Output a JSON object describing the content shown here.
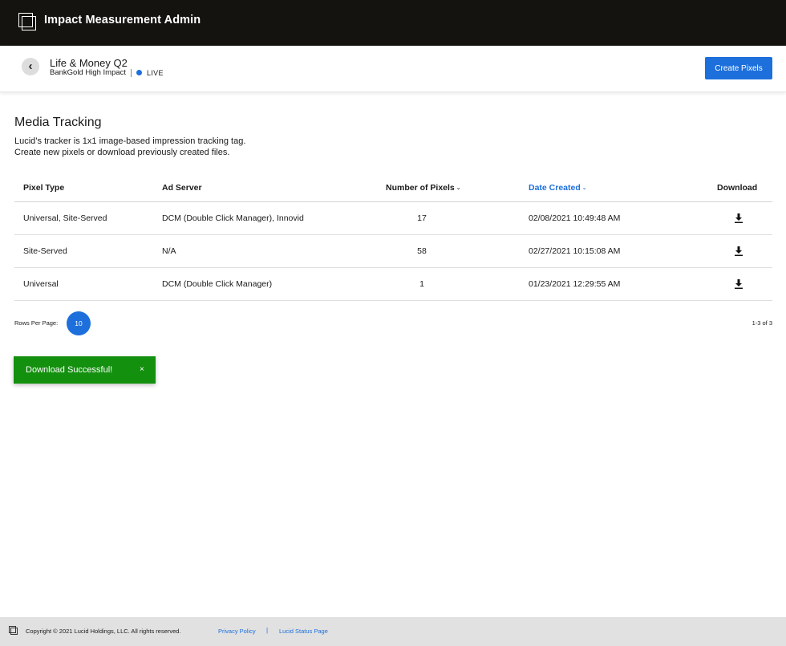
{
  "app": {
    "title": "Impact Measurement Admin",
    "logo_icon": "stacked-squares-logo-icon"
  },
  "subheader": {
    "back_icon": "chevron-left-icon",
    "campaign_title": "Life & Money Q2",
    "campaign_subtitle": "BankGold High Impact",
    "status": "LIVE",
    "status_color": "#1d6fdc",
    "create_button_label": "Create Pixels"
  },
  "section": {
    "title": "Media Tracking",
    "description_line1": "Lucid’s tracker is 1x1 image-based impression tracking tag.",
    "description_line2": "Create new pixels or download previously created files."
  },
  "table": {
    "headers": {
      "pixel_type": "Pixel Type",
      "ad_server": "Ad Server",
      "number_of_pixels": "Number of Pixels",
      "date_created": "Date Created",
      "download": "Download"
    },
    "sorted_by": "Date Created",
    "rows": [
      {
        "pixel_type": "Universal, Site-Served",
        "ad_server": "DCM (Double Click Manager), Innovid",
        "number_of_pixels": "17",
        "date_created": "02/08/2021 10:49:48 AM",
        "download_icon": "download-icon"
      },
      {
        "pixel_type": "Site-Served",
        "ad_server": "N/A",
        "number_of_pixels": "58",
        "date_created": "02/27/2021 10:15:08 AM",
        "download_icon": "download-icon"
      },
      {
        "pixel_type": "Universal",
        "ad_server": "DCM (Double Click Manager)",
        "number_of_pixels": "1",
        "date_created": "01/23/2021 12:29:55 AM",
        "download_icon": "download-icon"
      }
    ]
  },
  "pagination": {
    "rows_per_page_label": "Rows Per Page:",
    "rows_per_page_value": "10",
    "range": "1-3 of 3"
  },
  "toast": {
    "message": "Download Successful!",
    "close_label": "×",
    "color": "#14900f"
  },
  "footer": {
    "copyright": "Copyright © 2021 Lucid Holdings, LLC. All rights reserved.",
    "privacy_link": "Privacy Policy",
    "separator": "|",
    "status_link": "Lucid Status Page"
  },
  "colors": {
    "accent": "#1d6fdc",
    "appbar": "#15130f",
    "footer": "#e1e1e1"
  }
}
